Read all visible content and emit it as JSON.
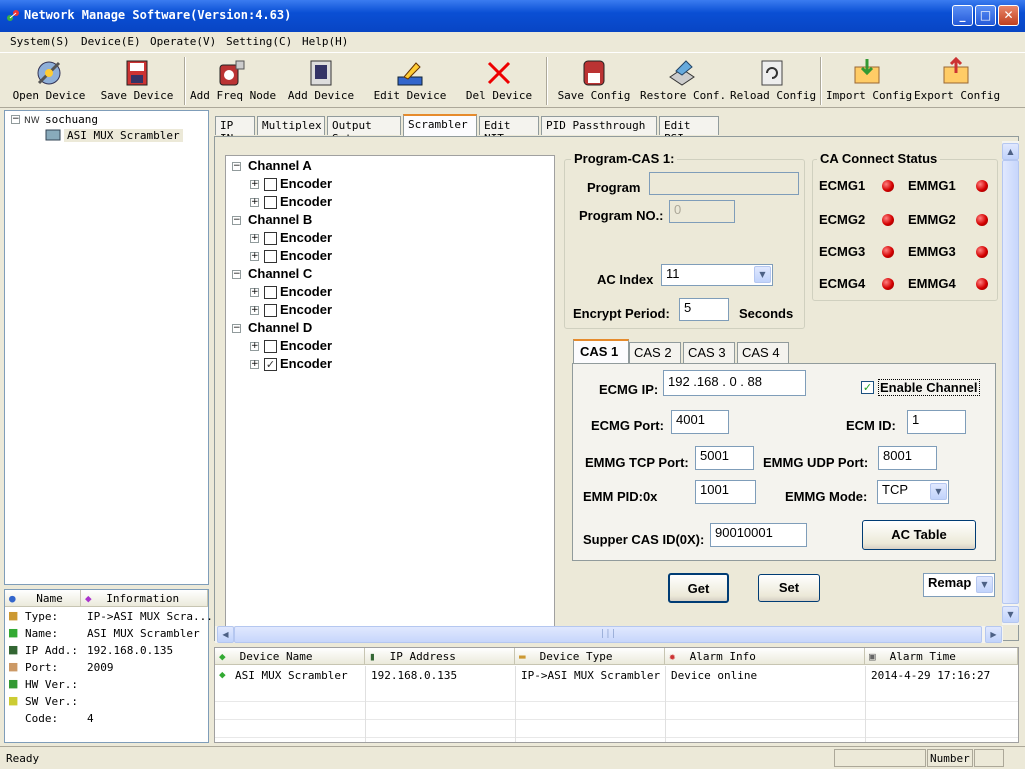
{
  "window": {
    "title": "Network Manage Software(Version:4.63)"
  },
  "menu": [
    {
      "label": "System(S)"
    },
    {
      "label": "Device(E)"
    },
    {
      "label": "Operate(V)"
    },
    {
      "label": "Setting(C)"
    },
    {
      "label": "Help(H)"
    }
  ],
  "toolbar": {
    "open_device": "Open Device",
    "save_device": "Save Device",
    "add_freq_node": "Add Freq Node",
    "add_device": "Add Device",
    "edit_device": "Edit Device",
    "del_device": "Del Device",
    "save_config": "Save Config",
    "restore_conf": "Restore Conf.",
    "reload_config": "Reload Config",
    "import_config": "Import Config",
    "export_config": "Export Config"
  },
  "tree": {
    "root": "sochuang",
    "child": "ASI MUX Scrambler"
  },
  "info": {
    "col_name": "Name",
    "col_info": "Information",
    "rows": [
      {
        "key": "Type:",
        "value": "IP->ASI MUX Scra..."
      },
      {
        "key": "Name:",
        "value": "ASI MUX Scrambler"
      },
      {
        "key": "IP Add.:",
        "value": "192.168.0.135"
      },
      {
        "key": "Port:",
        "value": "2009"
      },
      {
        "key": "HW Ver.:",
        "value": ""
      },
      {
        "key": "SW Ver.:",
        "value": ""
      },
      {
        "key": "Code:",
        "value": "4"
      }
    ]
  },
  "tabs": [
    {
      "label": "IP IN"
    },
    {
      "label": "Multiplex"
    },
    {
      "label": "Output Set"
    },
    {
      "label": "Scrambler"
    },
    {
      "label": "Edit NIT"
    },
    {
      "label": "PID Passthrough"
    },
    {
      "label": "Edit PSI"
    }
  ],
  "channels": {
    "a": "Channel A",
    "b": "Channel B",
    "c": "Channel C",
    "d": "Channel D",
    "encoder": "Encoder"
  },
  "program_cas": {
    "group": "Program-CAS 1:",
    "program_label": "Program",
    "program_value": "",
    "program_no_label": "Program NO.:",
    "program_no_value": "0",
    "ac_index_label": "AC Index",
    "ac_index_value": "11",
    "encrypt_label": "Encrypt Period:",
    "encrypt_value": "5",
    "seconds": "Seconds"
  },
  "ca_status": {
    "group": "CA Connect Status",
    "ecmg1": "ECMG1",
    "ecmg2": "ECMG2",
    "ecmg3": "ECMG3",
    "ecmg4": "ECMG4",
    "emmg1": "EMMG1",
    "emmg2": "EMMG2",
    "emmg3": "EMMG3",
    "emmg4": "EMMG4"
  },
  "cas_tabs": [
    {
      "label": "CAS 1"
    },
    {
      "label": "CAS 2"
    },
    {
      "label": "CAS 3"
    },
    {
      "label": "CAS 4"
    }
  ],
  "cas_form": {
    "ecmg_ip_label": "ECMG IP:",
    "ecmg_ip_value": "192 .168 .  0  . 88",
    "enable_channel": "Enable Channel",
    "ecmg_port_label": "ECMG Port:",
    "ecmg_port_value": "4001",
    "ecm_id_label": "ECM ID:",
    "ecm_id_value": "1",
    "emmg_tcp_label": "EMMG TCP Port:",
    "emmg_tcp_value": "5001",
    "emmg_udp_label": "EMMG UDP Port:",
    "emmg_udp_value": "8001",
    "emm_pid_label": "EMM PID:0x",
    "emm_pid_value": "1001",
    "emmg_mode_label": "EMMG Mode:",
    "emmg_mode_value": "TCP",
    "supper_cas_label": "Supper CAS ID(0X):",
    "supper_cas_value": "90010001",
    "ac_table": "AC Table"
  },
  "actions": {
    "get": "Get",
    "set": "Set",
    "remap": "Remap"
  },
  "device_table": {
    "headers": [
      "Device Name",
      "IP Address",
      "Device Type",
      "Alarm Info",
      "Alarm Time"
    ],
    "rows": [
      [
        "ASI MUX Scrambler",
        "192.168.0.135",
        "IP->ASI MUX Scrambler",
        "Device online",
        "2014-4-29 17:16:27"
      ]
    ]
  },
  "status": {
    "left": "Ready",
    "right": "Number"
  }
}
